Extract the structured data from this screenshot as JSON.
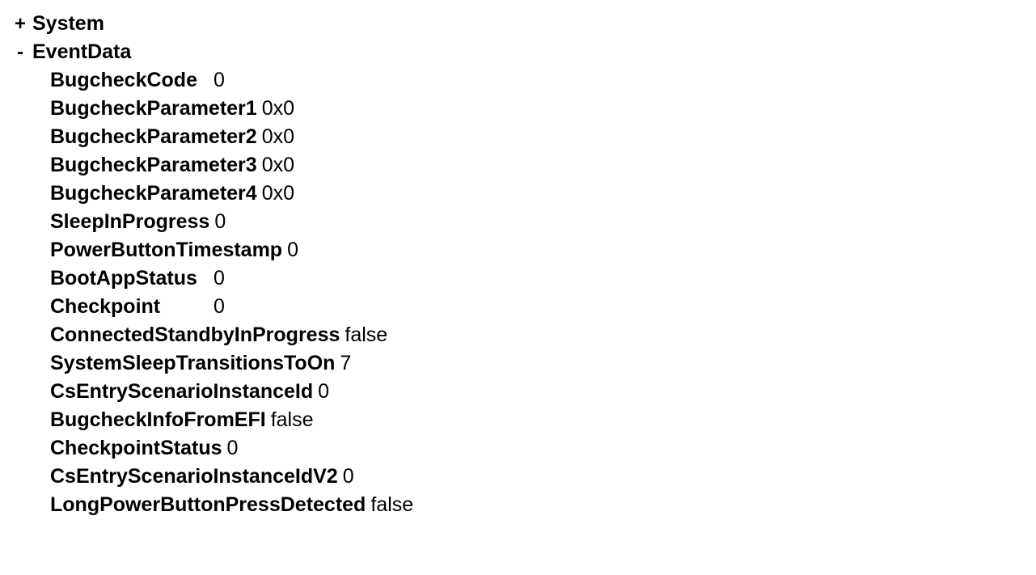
{
  "tree": {
    "system": {
      "toggle": "+",
      "label": "System"
    },
    "eventData": {
      "toggle": "-",
      "label": "EventData",
      "items": [
        {
          "name": "BugcheckCode",
          "value": "0",
          "spaced": true
        },
        {
          "name": "BugcheckParameter1",
          "value": "0x0",
          "spaced": false
        },
        {
          "name": "BugcheckParameter2",
          "value": "0x0",
          "spaced": false
        },
        {
          "name": "BugcheckParameter3",
          "value": "0x0",
          "spaced": false
        },
        {
          "name": "BugcheckParameter4",
          "value": "0x0",
          "spaced": false
        },
        {
          "name": "SleepInProgress",
          "value": "0",
          "spaced": true
        },
        {
          "name": "PowerButtonTimestamp",
          "value": "0",
          "spaced": false
        },
        {
          "name": "BootAppStatus",
          "value": "0",
          "spaced": true
        },
        {
          "name": "Checkpoint",
          "value": "0",
          "spaced": true
        },
        {
          "name": "ConnectedStandbyInProgress",
          "value": "false",
          "spaced": false
        },
        {
          "name": "SystemSleepTransitionsToOn",
          "value": "7",
          "spaced": false
        },
        {
          "name": "CsEntryScenarioInstanceId",
          "value": "0",
          "spaced": false
        },
        {
          "name": "BugcheckInfoFromEFI",
          "value": "false",
          "spaced": false
        },
        {
          "name": "CheckpointStatus",
          "value": "0",
          "spaced": false
        },
        {
          "name": "CsEntryScenarioInstanceIdV2",
          "value": "0",
          "spaced": false
        },
        {
          "name": "LongPowerButtonPressDetected",
          "value": "false",
          "spaced": false
        }
      ]
    }
  }
}
